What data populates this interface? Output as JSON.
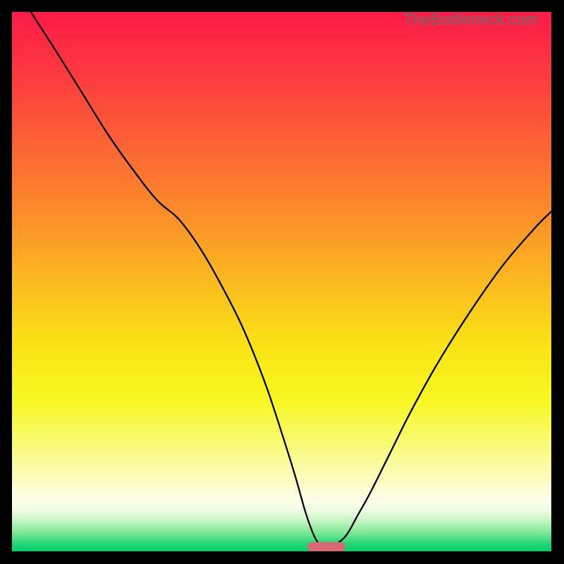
{
  "watermark": "TheBottleneck.com",
  "chart_data": {
    "type": "line",
    "title": "",
    "xlabel": "",
    "ylabel": "",
    "xlim": [
      0,
      100
    ],
    "ylim": [
      0,
      100
    ],
    "grid": false,
    "legend": false,
    "annotations": [],
    "background_gradient": {
      "stops": [
        {
          "offset": 0.0,
          "color": "#fd1b48"
        },
        {
          "offset": 0.12,
          "color": "#fd3b3f"
        },
        {
          "offset": 0.25,
          "color": "#fc6534"
        },
        {
          "offset": 0.38,
          "color": "#fb8f2a"
        },
        {
          "offset": 0.5,
          "color": "#fbba1f"
        },
        {
          "offset": 0.62,
          "color": "#fae415"
        },
        {
          "offset": 0.72,
          "color": "#f6f822"
        },
        {
          "offset": 0.8,
          "color": "#f9fa74"
        },
        {
          "offset": 0.86,
          "color": "#fcfcb9"
        },
        {
          "offset": 0.905,
          "color": "#fefeea"
        },
        {
          "offset": 0.925,
          "color": "#eefce2"
        },
        {
          "offset": 0.945,
          "color": "#c0f4bf"
        },
        {
          "offset": 0.965,
          "color": "#7de794"
        },
        {
          "offset": 0.985,
          "color": "#2bd576"
        },
        {
          "offset": 1.0,
          "color": "#02ce6c"
        }
      ]
    },
    "series": [
      {
        "name": "bottleneck-curve",
        "color": "#000000",
        "x": [
          3.5,
          8,
          13,
          18,
          23,
          27,
          31,
          35,
          39,
          43,
          47,
          50,
          52.5,
          54.5,
          56.2,
          57.5,
          58.5,
          60,
          62,
          64,
          66.5,
          70,
          74,
          79,
          85,
          91,
          97,
          100
        ],
        "y": [
          100,
          93,
          85,
          77,
          70,
          65,
          61.5,
          56,
          49,
          41,
          31,
          22,
          14,
          7,
          2.5,
          1.1,
          1.0,
          1.3,
          3,
          6.5,
          11,
          18,
          26,
          35,
          44.5,
          53,
          60,
          63
        ]
      }
    ],
    "marker": {
      "name": "optimal-range-marker",
      "shape": "pill",
      "color": "#d76a74",
      "x_center": 58.3,
      "width_x": 7.0,
      "y": 0.8,
      "height_y": 1.8
    }
  }
}
